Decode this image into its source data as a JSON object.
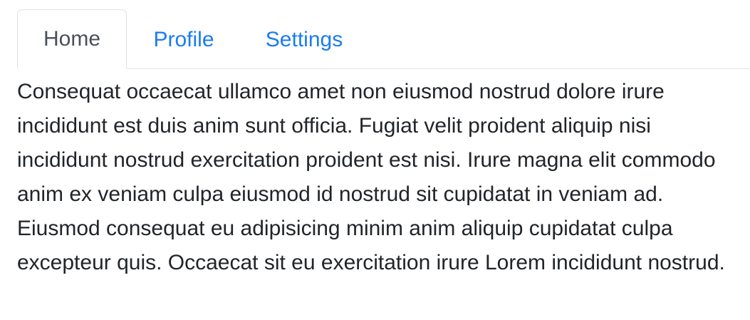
{
  "tabs": [
    {
      "label": "Home",
      "active": true
    },
    {
      "label": "Profile",
      "active": false
    },
    {
      "label": "Settings",
      "active": false
    }
  ],
  "content": {
    "text": "Consequat occaecat ullamco amet non eiusmod nostrud dolore irure incididunt est duis anim sunt officia. Fugiat velit proident aliquip nisi incididunt nostrud exercitation proident est nisi. Irure magna elit commodo anim ex veniam culpa eiusmod id nostrud sit cupidatat in veniam ad. Eiusmod consequat eu adipisicing minim anim aliquip cupidatat culpa excepteur quis. Occaecat sit eu exercitation irure Lorem incididunt nostrud."
  },
  "colors": {
    "link": "#1a7cf0",
    "active_tab_text": "#495057",
    "body_text": "#212529",
    "border": "#dee2e6"
  }
}
